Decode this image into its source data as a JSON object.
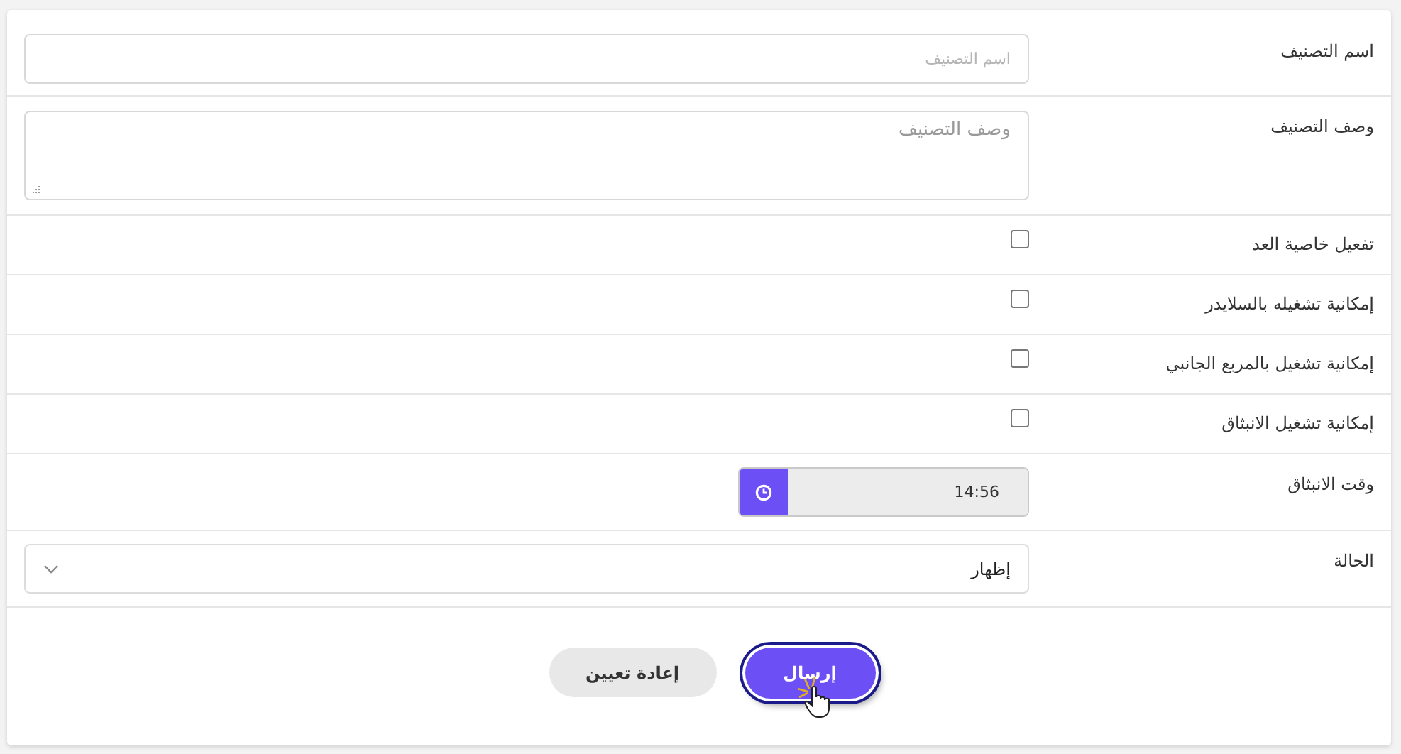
{
  "fields": [
    {
      "kind": "text",
      "label": "اسم التصنيف",
      "placeholder": "اسم التصنيف"
    },
    {
      "kind": "textarea",
      "label": "وصف التصنيف",
      "placeholder": "وصف التصنيف"
    },
    {
      "kind": "checkbox",
      "label": "تفعيل خاصية العد",
      "checked": false
    },
    {
      "kind": "checkbox",
      "label": "إمكانية تشغيله بالسلايدر",
      "checked": false
    },
    {
      "kind": "checkbox",
      "label": "إمكانية تشغيل بالمربع الجانبي",
      "checked": false
    },
    {
      "kind": "checkbox",
      "label": "إمكانية تشغيل الانبثاق",
      "checked": false
    },
    {
      "kind": "time",
      "label": "وقت الانبثاق",
      "value": "14:56"
    },
    {
      "kind": "select",
      "label": "الحالة",
      "value": "إظهار"
    }
  ],
  "buttons": {
    "submit": "إرسال",
    "reset": "إعادة تعيين"
  }
}
